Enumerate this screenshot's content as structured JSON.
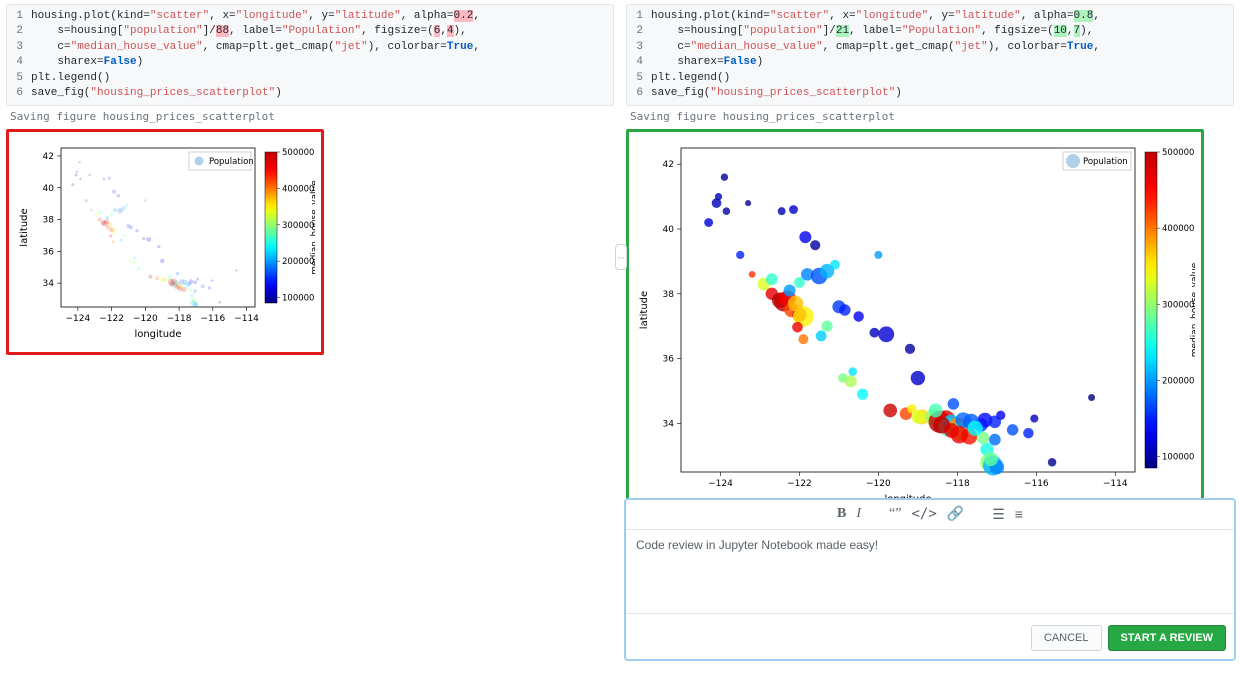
{
  "left": {
    "code": {
      "lines": [
        {
          "n": "1",
          "segments": [
            "housing.plot(kind=",
            [
              "str",
              "\"scatter\""
            ],
            ", x=",
            [
              "str",
              "\"longitude\""
            ],
            ", y=",
            [
              "str",
              "\"latitude\""
            ],
            ", alpha=",
            [
              "hl",
              "0.2"
            ],
            ","
          ]
        },
        {
          "n": "2",
          "segments": [
            "    s=housing[",
            [
              "str",
              "\"population\""
            ],
            "]/",
            [
              "hl",
              "88"
            ],
            ", label=",
            [
              "str",
              "\"Population\""
            ],
            ", figsize=(",
            [
              "hl",
              "6"
            ],
            ",",
            [
              "hl",
              "4"
            ],
            "),"
          ]
        },
        {
          "n": "3",
          "segments": [
            "    c=",
            [
              "str",
              "\"median_house_value\""
            ],
            ", cmap=plt.get_cmap(",
            [
              "str",
              "\"jet\""
            ],
            "), colorbar=",
            [
              "bool",
              "True"
            ],
            ","
          ]
        },
        {
          "n": "4",
          "segments": [
            "    sharex=",
            [
              "bool",
              "False"
            ],
            ")"
          ]
        },
        {
          "n": "5",
          "segments": [
            "plt.legend()"
          ]
        },
        {
          "n": "6",
          "segments": [
            "save_fig(",
            [
              "str",
              "\"housing_prices_scatterplot\""
            ],
            ")"
          ]
        }
      ]
    },
    "output_text": "Saving figure housing_prices_scatterplot"
  },
  "right": {
    "code": {
      "lines": [
        {
          "n": "1",
          "segments": [
            "housing.plot(kind=",
            [
              "str",
              "\"scatter\""
            ],
            ", x=",
            [
              "str",
              "\"longitude\""
            ],
            ", y=",
            [
              "str",
              "\"latitude\""
            ],
            ", alpha=",
            [
              "hl",
              "0.8"
            ],
            ","
          ]
        },
        {
          "n": "2",
          "segments": [
            "    s=housing[",
            [
              "str",
              "\"population\""
            ],
            "]/",
            [
              "hl",
              "21"
            ],
            ", label=",
            [
              "str",
              "\"Population\""
            ],
            ", figsize=(",
            [
              "hl",
              "10"
            ],
            ",",
            [
              "hl",
              "7"
            ],
            "),"
          ]
        },
        {
          "n": "3",
          "segments": [
            "    c=",
            [
              "str",
              "\"median_house_value\""
            ],
            ", cmap=plt.get_cmap(",
            [
              "str",
              "\"jet\""
            ],
            "), colorbar=",
            [
              "bool",
              "True"
            ],
            ","
          ]
        },
        {
          "n": "4",
          "segments": [
            "    sharex=",
            [
              "bool",
              "False"
            ],
            ")"
          ]
        },
        {
          "n": "5",
          "segments": [
            "plt.legend()"
          ]
        },
        {
          "n": "6",
          "segments": [
            "save_fig(",
            [
              "str",
              "\"housing_prices_scatterplot\""
            ],
            ")"
          ]
        }
      ]
    },
    "output_text": "Saving figure housing_prices_scatterplot"
  },
  "comment": {
    "text": "Code review in Jupyter Notebook made easy!",
    "cancel_label": "CANCEL",
    "submit_label": "START A REVIEW"
  },
  "chart_data": [
    {
      "type": "scatter",
      "side": "left",
      "title": "",
      "xlabel": "longitude",
      "ylabel": "latitude",
      "legend_label": "Population",
      "colorbar_label": "median_house_value",
      "xlim": [
        -125,
        -113.5
      ],
      "ylim": [
        32.5,
        42.5
      ],
      "xticks": [
        -124,
        -122,
        -120,
        -118,
        -116,
        -114
      ],
      "yticks": [
        34,
        36,
        38,
        40,
        42
      ],
      "colorbar_ticks": [
        100000,
        200000,
        300000,
        400000,
        500000
      ],
      "alpha": 0.2,
      "size_divisor": 88,
      "colormap": "jet"
    },
    {
      "type": "scatter",
      "side": "right",
      "title": "",
      "xlabel": "longitude",
      "ylabel": "latitude",
      "legend_label": "Population",
      "colorbar_label": "median_house_value",
      "xlim": [
        -125,
        -113.5
      ],
      "ylim": [
        32.5,
        42.5
      ],
      "xticks": [
        -124,
        -122,
        -120,
        -118,
        -116,
        -114
      ],
      "yticks": [
        34,
        36,
        38,
        40,
        42
      ],
      "colorbar_ticks": [
        100000,
        200000,
        300000,
        400000,
        500000
      ],
      "alpha": 0.8,
      "size_divisor": 21,
      "colormap": "jet"
    }
  ],
  "shared_points": [
    {
      "lon": -124.3,
      "lat": 40.2,
      "pop": 2600,
      "val": 120000
    },
    {
      "lon": -124.1,
      "lat": 40.8,
      "pop": 3100,
      "val": 110000
    },
    {
      "lon": -123.9,
      "lat": 41.6,
      "pop": 1800,
      "val": 95000
    },
    {
      "lon": -123.5,
      "lat": 39.2,
      "pop": 2200,
      "val": 150000
    },
    {
      "lon": -123.2,
      "lat": 38.6,
      "pop": 1500,
      "val": 430000
    },
    {
      "lon": -122.9,
      "lat": 38.3,
      "pop": 5400,
      "val": 330000
    },
    {
      "lon": -122.7,
      "lat": 38.0,
      "pop": 5000,
      "val": 470000
    },
    {
      "lon": -122.5,
      "lat": 37.8,
      "pop": 8000,
      "val": 500000
    },
    {
      "lon": -122.4,
      "lat": 37.75,
      "pop": 12000,
      "val": 500000
    },
    {
      "lon": -122.3,
      "lat": 37.85,
      "pop": 9000,
      "val": 450000
    },
    {
      "lon": -122.2,
      "lat": 37.5,
      "pop": 7000,
      "val": 420000
    },
    {
      "lon": -122.0,
      "lat": 37.35,
      "pop": 6500,
      "val": 480000
    },
    {
      "lon": -121.9,
      "lat": 37.3,
      "pop": 14000,
      "val": 350000
    },
    {
      "lon": -121.8,
      "lat": 38.6,
      "pop": 5200,
      "val": 190000
    },
    {
      "lon": -121.6,
      "lat": 39.5,
      "pop": 3400,
      "val": 100000
    },
    {
      "lon": -121.5,
      "lat": 38.55,
      "pop": 9000,
      "val": 170000
    },
    {
      "lon": -121.3,
      "lat": 38.7,
      "pop": 6800,
      "val": 210000
    },
    {
      "lon": -121.3,
      "lat": 37.0,
      "pop": 4200,
      "val": 280000
    },
    {
      "lon": -121.0,
      "lat": 37.6,
      "pop": 5600,
      "val": 160000
    },
    {
      "lon": -120.9,
      "lat": 35.4,
      "pop": 3000,
      "val": 290000
    },
    {
      "lon": -120.7,
      "lat": 35.3,
      "pop": 4700,
      "val": 310000
    },
    {
      "lon": -120.5,
      "lat": 37.3,
      "pop": 3600,
      "val": 130000
    },
    {
      "lon": -120.4,
      "lat": 34.9,
      "pop": 4100,
      "val": 240000
    },
    {
      "lon": -120.1,
      "lat": 36.8,
      "pop": 3200,
      "val": 110000
    },
    {
      "lon": -120.0,
      "lat": 39.2,
      "pop": 2100,
      "val": 200000
    },
    {
      "lon": -119.8,
      "lat": 36.75,
      "pop": 8200,
      "val": 120000
    },
    {
      "lon": -119.7,
      "lat": 34.4,
      "pop": 6100,
      "val": 490000
    },
    {
      "lon": -119.3,
      "lat": 34.3,
      "pop": 5200,
      "val": 420000
    },
    {
      "lon": -119.2,
      "lat": 36.3,
      "pop": 3400,
      "val": 100000
    },
    {
      "lon": -119.0,
      "lat": 35.4,
      "pop": 6800,
      "val": 115000
    },
    {
      "lon": -118.9,
      "lat": 34.2,
      "pop": 7400,
      "val": 360000
    },
    {
      "lon": -118.6,
      "lat": 34.2,
      "pop": 9200,
      "val": 300000
    },
    {
      "lon": -118.45,
      "lat": 34.05,
      "pop": 16000,
      "val": 500000
    },
    {
      "lon": -118.3,
      "lat": 34.1,
      "pop": 13000,
      "val": 470000
    },
    {
      "lon": -118.25,
      "lat": 33.9,
      "pop": 11000,
      "val": 260000
    },
    {
      "lon": -118.15,
      "lat": 34.0,
      "pop": 10000,
      "val": 220000
    },
    {
      "lon": -118.0,
      "lat": 33.85,
      "pop": 14000,
      "val": 390000
    },
    {
      "lon": -117.9,
      "lat": 33.75,
      "pop": 12000,
      "val": 310000
    },
    {
      "lon": -117.85,
      "lat": 34.1,
      "pop": 8000,
      "val": 180000
    },
    {
      "lon": -117.7,
      "lat": 33.6,
      "pop": 8600,
      "val": 440000
    },
    {
      "lon": -117.4,
      "lat": 33.95,
      "pop": 6000,
      "val": 160000
    },
    {
      "lon": -117.3,
      "lat": 34.1,
      "pop": 7200,
      "val": 140000
    },
    {
      "lon": -117.25,
      "lat": 33.2,
      "pop": 5800,
      "val": 250000
    },
    {
      "lon": -117.2,
      "lat": 32.8,
      "pop": 10000,
      "val": 300000
    },
    {
      "lon": -117.1,
      "lat": 32.7,
      "pop": 13000,
      "val": 210000
    },
    {
      "lon": -117.05,
      "lat": 33.5,
      "pop": 4500,
      "val": 180000
    },
    {
      "lon": -117.0,
      "lat": 32.65,
      "pop": 7000,
      "val": 190000
    },
    {
      "lon": -116.9,
      "lat": 34.25,
      "pop": 2800,
      "val": 130000
    },
    {
      "lon": -116.6,
      "lat": 33.8,
      "pop": 4300,
      "val": 170000
    },
    {
      "lon": -116.2,
      "lat": 33.7,
      "pop": 3600,
      "val": 150000
    },
    {
      "lon": -115.6,
      "lat": 32.8,
      "pop": 2400,
      "val": 90000
    },
    {
      "lon": -121.9,
      "lat": 36.6,
      "pop": 3300,
      "val": 400000
    },
    {
      "lon": -122.05,
      "lat": 36.97,
      "pop": 3700,
      "val": 460000
    },
    {
      "lon": -122.7,
      "lat": 38.45,
      "pop": 4600,
      "val": 260000
    },
    {
      "lon": -118.4,
      "lat": 33.95,
      "pop": 9500,
      "val": 500000
    },
    {
      "lon": -118.15,
      "lat": 33.78,
      "pop": 7300,
      "val": 480000
    },
    {
      "lon": -121.1,
      "lat": 38.9,
      "pop": 3100,
      "val": 230000
    },
    {
      "lon": -122.1,
      "lat": 37.7,
      "pop": 7800,
      "val": 370000
    },
    {
      "lon": -122.25,
      "lat": 38.1,
      "pop": 4800,
      "val": 200000
    },
    {
      "lon": -119.0,
      "lat": 34.2,
      "pop": 5800,
      "val": 330000
    },
    {
      "lon": -122.15,
      "lat": 40.6,
      "pop": 2600,
      "val": 115000
    },
    {
      "lon": -121.85,
      "lat": 39.75,
      "pop": 4700,
      "val": 130000
    },
    {
      "lon": -122.45,
      "lat": 40.55,
      "pop": 2100,
      "val": 105000
    },
    {
      "lon": -123.85,
      "lat": 40.55,
      "pop": 1900,
      "val": 100000
    },
    {
      "lon": -117.65,
      "lat": 34.05,
      "pop": 8500,
      "val": 175000
    },
    {
      "lon": -117.95,
      "lat": 33.65,
      "pop": 9800,
      "val": 460000
    },
    {
      "lon": -119.15,
      "lat": 34.45,
      "pop": 2800,
      "val": 350000
    },
    {
      "lon": -120.65,
      "lat": 35.6,
      "pop": 2400,
      "val": 230000
    },
    {
      "lon": -120.85,
      "lat": 37.5,
      "pop": 4300,
      "val": 150000
    },
    {
      "lon": -117.15,
      "lat": 32.9,
      "pop": 6600,
      "val": 280000
    },
    {
      "lon": -121.45,
      "lat": 36.7,
      "pop": 3900,
      "val": 220000
    },
    {
      "lon": -122.0,
      "lat": 38.35,
      "pop": 3800,
      "val": 260000
    },
    {
      "lon": -118.55,
      "lat": 34.4,
      "pop": 6300,
      "val": 270000
    },
    {
      "lon": -114.6,
      "lat": 34.8,
      "pop": 1600,
      "val": 80000
    },
    {
      "lon": -116.05,
      "lat": 34.15,
      "pop": 2200,
      "val": 110000
    },
    {
      "lon": -118.1,
      "lat": 34.6,
      "pop": 4400,
      "val": 170000
    },
    {
      "lon": -117.35,
      "lat": 33.55,
      "pop": 5200,
      "val": 290000
    },
    {
      "lon": -117.55,
      "lat": 33.85,
      "pop": 7700,
      "val": 240000
    },
    {
      "lon": -117.05,
      "lat": 34.05,
      "pop": 5100,
      "val": 150000
    },
    {
      "lon": -124.05,
      "lat": 41.0,
      "pop": 1700,
      "val": 105000
    },
    {
      "lon": -123.3,
      "lat": 40.8,
      "pop": 1200,
      "val": 90000
    }
  ]
}
